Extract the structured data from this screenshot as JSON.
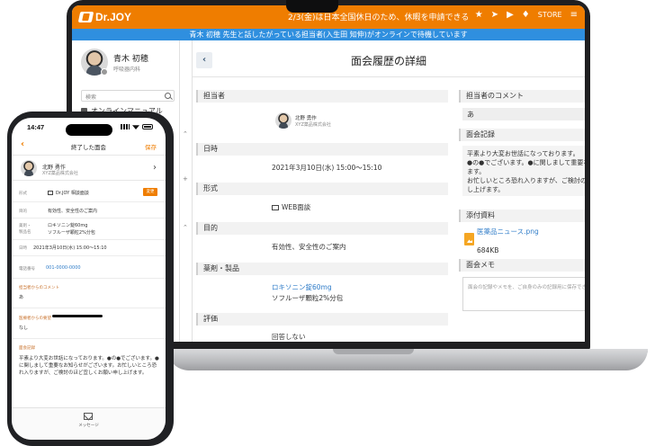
{
  "laptop": {
    "topbar": {
      "logo_text": "Dr.JOY",
      "notice": "2/3(金)は日本全国休日のため、休暇を申請できるよ...",
      "store_label": "STORE",
      "icons": [
        "star-icon",
        "send-icon",
        "play-icon",
        "bulb-icon",
        "menu-icon"
      ]
    },
    "bluebar_text": "青木 初穂 先生と話したがっている担当者(入生田 知伸)がオンラインで待機しています",
    "sidebar": {
      "user_name": "青木 初穂",
      "user_dept": "呼吸器内科",
      "search_placeholder": "検索",
      "manual_label": "オンラインマニュアル"
    },
    "main": {
      "title": "面会履歴の詳細",
      "left": {
        "rep_head": "担当者",
        "rep_name": "北野 勇作",
        "rep_company": "XYZ薬品株式会社",
        "datetime_head": "日時",
        "datetime": "2021年3月10日(水) 15:00〜15:10",
        "format_head": "形式",
        "format": "WEB面談",
        "purpose_head": "目的",
        "purpose": "有効性、安全性のご案内",
        "drug_head": "薬剤・製品",
        "drug_1": "ロキソニン錠60mg",
        "drug_2": "ソフルーザ顆粒2%分包",
        "eval_head": "評価",
        "eval": "回答しない"
      },
      "right": {
        "comment_head": "担当者のコメント",
        "comment": "あ",
        "record_head": "面会記録",
        "record_1": "平素より大変お世話になっております。",
        "record_2": "●の●でございます。●に関しまして重要なお知らせがございます。",
        "record_3": "お忙しいところ恐れ入りますが、ご検討のほど宜しくお願い申し上げます。",
        "attachment_head": "添付資料",
        "file_name": "医薬品ニュース.png",
        "file_size": "684KB",
        "memo_head": "面会メモ",
        "memo_placeholder": "面会の記録やメモを、ご自身のみの記録用に保存できます。"
      }
    }
  },
  "phone": {
    "time": "14:47",
    "nav_title": "終了した面会",
    "save_label": "保存",
    "rep_name": "北野 勇作",
    "rep_company": "XYZ薬品株式会社",
    "format_label": "形式",
    "format_value": "Dr.JOY 相談面談",
    "change_label": "変更",
    "purpose_label": "目的",
    "purpose_value": "有効性、安全性のご案内",
    "drug_label_1": "薬剤・",
    "drug_label_2": "製品名",
    "drug_1": "ロキソニン錠60mg",
    "drug_2": "ソフルーザ顆粒2%分包",
    "datetime_label": "日時",
    "datetime_value": "2021年3月10日(水) 15:00〜15:10",
    "phone_label": "電話番号",
    "phone_value": "001-0000-0000",
    "rep_comment_label": "担当者からのコメント",
    "rep_comment_value": "あ",
    "doctor_req_label": "医療者からの要望",
    "doctor_req_value": "なし",
    "record_label": "面会記録",
    "record_text": "平素より大変お世話になっております。●の●でございます。●に関しまして重要なお知らせがございます。お忙しいところ恐れ入りますが、ご検討のほど宜しくお願い申し上げます。",
    "tab_label": "メッセージ"
  }
}
